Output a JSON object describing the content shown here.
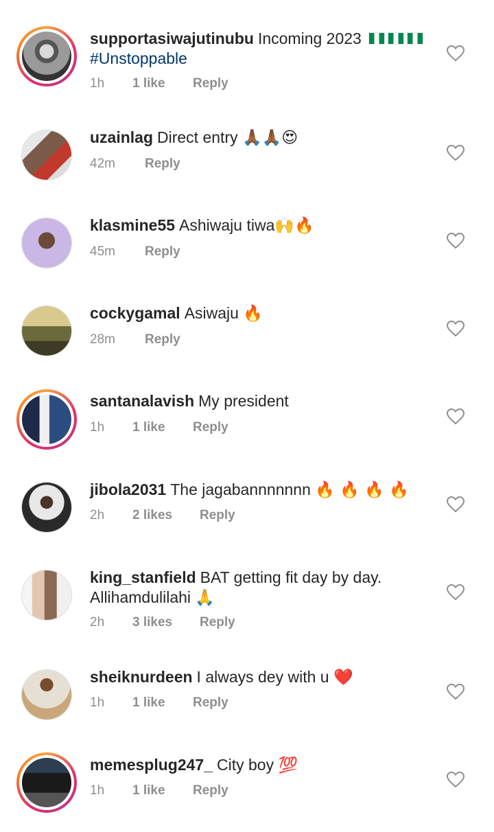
{
  "comments": [
    {
      "username": "supportasiwajutinubu",
      "text": "Incoming 2023",
      "hashtag": "#Unstoppable",
      "time": "1h",
      "likes": "1 like",
      "reply": "Reply",
      "story_ring": true,
      "avatar": "man-portrait-black-white"
    },
    {
      "username": "uzainlag",
      "text": "Direct entry",
      "emoji": "🙏🏾🙏🏾😍",
      "time": "42m",
      "likes": "",
      "reply": "Reply",
      "story_ring": false,
      "avatar": "selfie-red-shirt"
    },
    {
      "username": "klasmine55",
      "text": "Ashiwaju tiwa",
      "emoji": "🙌🔥",
      "time": "45m",
      "likes": "",
      "reply": "Reply",
      "story_ring": false,
      "avatar": "man-purple-background"
    },
    {
      "username": "cockygamal",
      "text": "Asiwaju",
      "emoji": "🔥",
      "time": "28m",
      "likes": "",
      "reply": "Reply",
      "story_ring": false,
      "avatar": "man-arms-raised-field"
    },
    {
      "username": "santanalavish",
      "text": "My president",
      "time": "1h",
      "likes": "1 like",
      "reply": "Reply",
      "story_ring": true,
      "avatar": "couple-portrait"
    },
    {
      "username": "jibola2031",
      "text": "The jagabannnnnnn",
      "emoji": "🔥 🔥 🔥 🔥",
      "time": "2h",
      "likes": "2 likes",
      "reply": "Reply",
      "story_ring": false,
      "avatar": "man-white-shirt-night"
    },
    {
      "username": "king_stanfield",
      "text": "BAT getting fit day by day. Allihamdulilahi",
      "emoji": "🙏",
      "time": "2h",
      "likes": "3 likes",
      "reply": "Reply",
      "story_ring": false,
      "avatar": "father-and-child"
    },
    {
      "username": "sheiknurdeen",
      "text": "I always dey with u",
      "emoji": "❤️",
      "time": "1h",
      "likes": "1 like",
      "reply": "Reply",
      "story_ring": false,
      "avatar": "man-white-robe"
    },
    {
      "username": "memesplug247_",
      "text": "City boy",
      "emoji": "💯",
      "time": "1h",
      "likes": "1 like",
      "reply": "Reply",
      "story_ring": true,
      "avatar": "black-suv"
    }
  ]
}
